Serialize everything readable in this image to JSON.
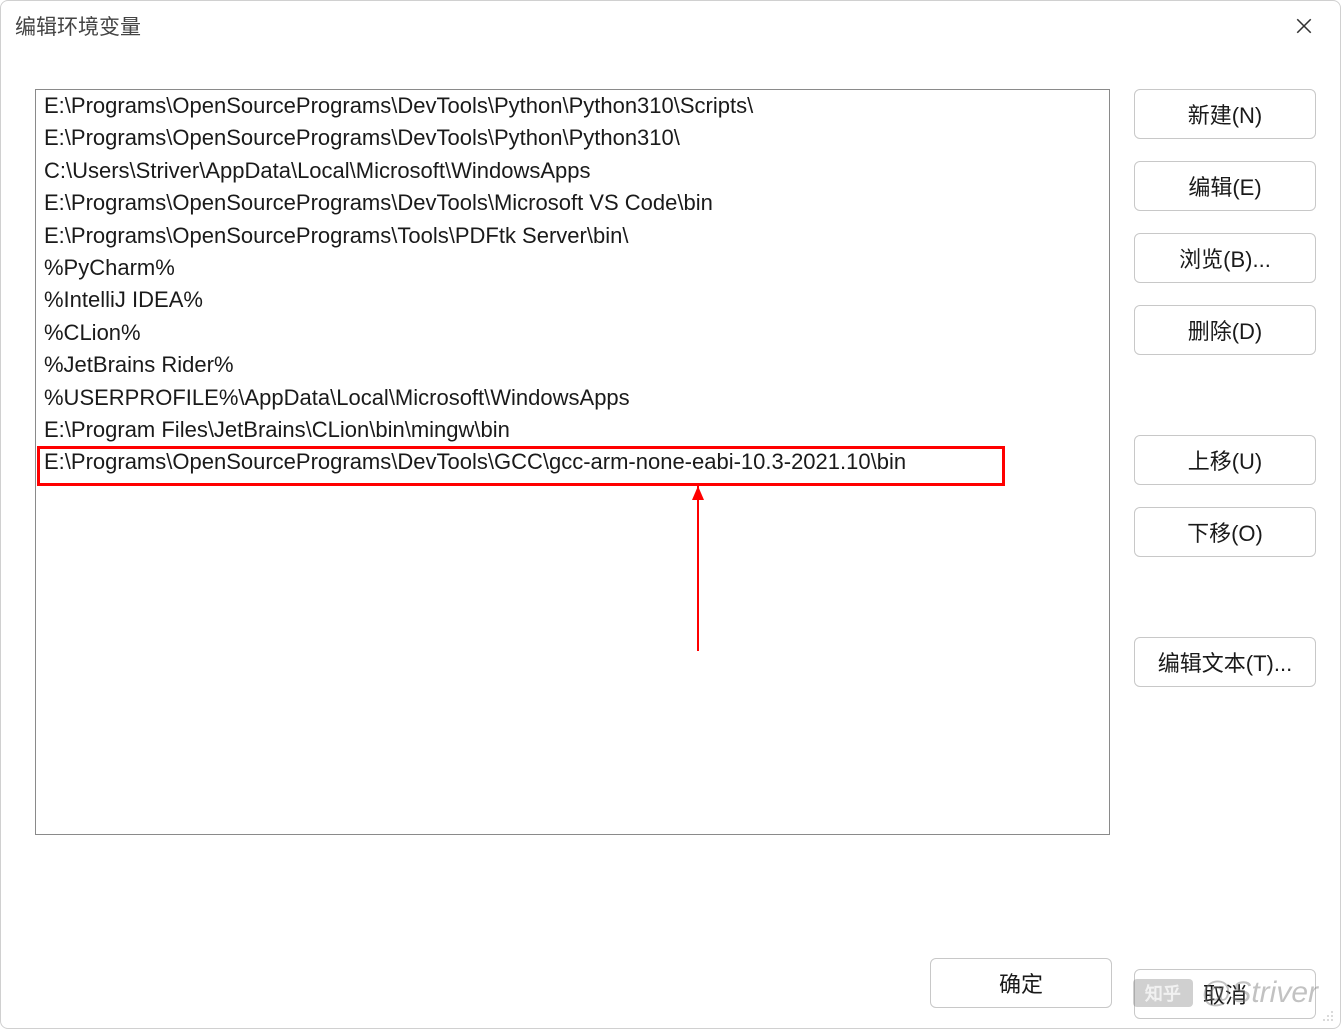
{
  "title": "编辑环境变量",
  "list": {
    "items": [
      "E:\\Programs\\OpenSourcePrograms\\DevTools\\Python\\Python310\\Scripts\\",
      "E:\\Programs\\OpenSourcePrograms\\DevTools\\Python\\Python310\\",
      "C:\\Users\\Striver\\AppData\\Local\\Microsoft\\WindowsApps",
      "E:\\Programs\\OpenSourcePrograms\\DevTools\\Microsoft VS Code\\bin",
      "E:\\Programs\\OpenSourcePrograms\\Tools\\PDFtk Server\\bin\\",
      "%PyCharm%",
      "%IntelliJ IDEA%",
      "%CLion%",
      "%JetBrains Rider%",
      "%USERPROFILE%\\AppData\\Local\\Microsoft\\WindowsApps",
      "E:\\Program Files\\JetBrains\\CLion\\bin\\mingw\\bin",
      "E:\\Programs\\OpenSourcePrograms\\DevTools\\GCC\\gcc-arm-none-eabi-10.3-2021.10\\bin"
    ],
    "highlighted_index": 11
  },
  "buttons": {
    "new": "新建(N)",
    "edit": "编辑(E)",
    "browse": "浏览(B)...",
    "delete": "删除(D)",
    "move_up": "上移(U)",
    "move_down": "下移(O)",
    "edit_text": "编辑文本(T)...",
    "ok": "确定",
    "cancel": "取消"
  },
  "watermark": {
    "brand": "知乎",
    "author": "@Striver"
  }
}
